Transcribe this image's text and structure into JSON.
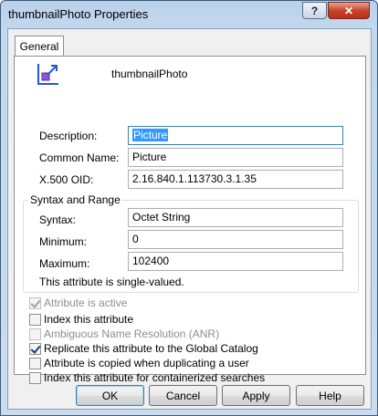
{
  "window": {
    "title": "thumbnailPhoto Properties"
  },
  "titlebar": {
    "help_label": "?",
    "close_label": "✕"
  },
  "tabs": [
    {
      "label": "General"
    }
  ],
  "header": {
    "name": "thumbnailPhoto",
    "icon": "schema-attribute-icon"
  },
  "fields": {
    "description": {
      "label": "Description:",
      "value": "Picture"
    },
    "common_name": {
      "label": "Common Name:",
      "value": "Picture"
    },
    "oid": {
      "label": "X.500 OID:",
      "value": "2.16.840.1.113730.3.1.35"
    }
  },
  "syntax_group": {
    "title": "Syntax and Range",
    "syntax": {
      "label": "Syntax:",
      "value": "Octet String"
    },
    "minimum": {
      "label": "Minimum:",
      "value": "0"
    },
    "maximum": {
      "label": "Maximum:",
      "value": "102400"
    },
    "note": "This attribute is single-valued."
  },
  "checkboxes": [
    {
      "label": "Attribute is active",
      "checked": true,
      "disabled": true
    },
    {
      "label": "Index this attribute",
      "checked": false,
      "disabled": false
    },
    {
      "label": "Ambiguous Name Resolution (ANR)",
      "checked": false,
      "disabled": true
    },
    {
      "label": "Replicate this attribute to the Global Catalog",
      "checked": true,
      "disabled": false
    },
    {
      "label": "Attribute is copied when duplicating a user",
      "checked": false,
      "disabled": false
    },
    {
      "label": "Index this attribute for containerized searches",
      "checked": false,
      "disabled": false
    }
  ],
  "buttons": {
    "ok": "OK",
    "cancel": "Cancel",
    "apply": "Apply",
    "help": "Help"
  }
}
